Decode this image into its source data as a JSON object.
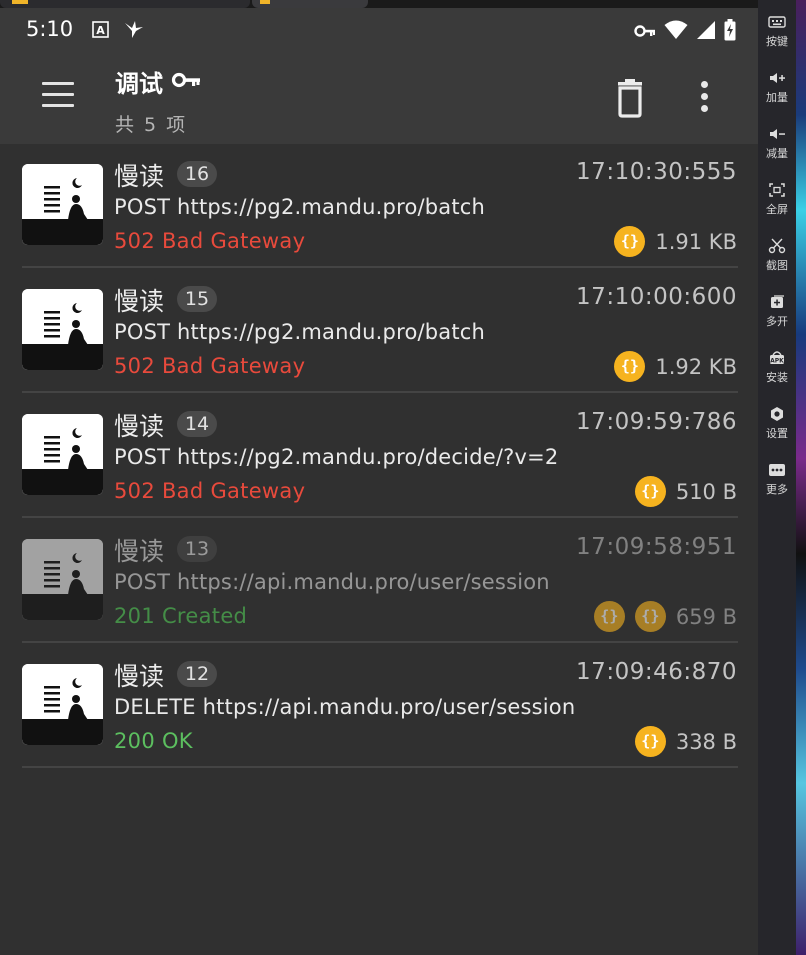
{
  "statusbar": {
    "time": "5:10",
    "icons": [
      "font-a-icon",
      "bird-icon",
      "key-icon",
      "wifi-icon",
      "signal-icon",
      "battery-charging-icon"
    ]
  },
  "toolbar": {
    "title": "调试",
    "title_icon": "key-icon",
    "subtitle": "共 5 项",
    "menu_icon": "hamburger-menu-icon",
    "delete_icon": "trash-icon",
    "more_icon": "more-vertical-icon"
  },
  "requests": [
    {
      "app": "慢读",
      "id": "16",
      "time": "17:10:30:555",
      "request": "POST https://pg2.mandu.pro/batch",
      "status": "502 Bad Gateway",
      "status_type": "error",
      "json_icons": 1,
      "size": "1.91 KB",
      "dimmed": false
    },
    {
      "app": "慢读",
      "id": "15",
      "time": "17:10:00:600",
      "request": "POST https://pg2.mandu.pro/batch",
      "status": "502 Bad Gateway",
      "status_type": "error",
      "json_icons": 1,
      "size": "1.92 KB",
      "dimmed": false
    },
    {
      "app": "慢读",
      "id": "14",
      "time": "17:09:59:786",
      "request": "POST https://pg2.mandu.pro/decide/?v=2",
      "status": "502 Bad Gateway",
      "status_type": "error",
      "json_icons": 1,
      "size": "510 B",
      "dimmed": false
    },
    {
      "app": "慢读",
      "id": "13",
      "time": "17:09:58:951",
      "request": "POST https://api.mandu.pro/user/session",
      "status": "201 Created",
      "status_type": "success",
      "json_icons": 2,
      "size": "659 B",
      "dimmed": true
    },
    {
      "app": "慢读",
      "id": "12",
      "time": "17:09:46:870",
      "request": "DELETE https://api.mandu.pro/user/session",
      "status": "200 OK",
      "status_type": "success",
      "json_icons": 1,
      "size": "338 B",
      "dimmed": false
    }
  ],
  "json_icon_glyph": "{}",
  "sidebar": {
    "items": [
      {
        "label": "按键",
        "icon": "keyboard-icon"
      },
      {
        "label": "加量",
        "icon": "volume-up-icon"
      },
      {
        "label": "减量",
        "icon": "volume-down-icon"
      },
      {
        "label": "全屏",
        "icon": "fullscreen-icon"
      },
      {
        "label": "截图",
        "icon": "scissors-icon"
      },
      {
        "label": "多开",
        "icon": "multi-open-icon"
      },
      {
        "label": "安装",
        "icon": "apk-install-icon"
      },
      {
        "label": "设置",
        "icon": "settings-gear-icon"
      },
      {
        "label": "更多",
        "icon": "more-dots-icon"
      }
    ]
  },
  "colors": {
    "error": "#e84a3c",
    "success": "#5cbf5f",
    "json_badge": "#f6b31f",
    "background": "#303030",
    "toolbar": "#3a3a3a"
  }
}
